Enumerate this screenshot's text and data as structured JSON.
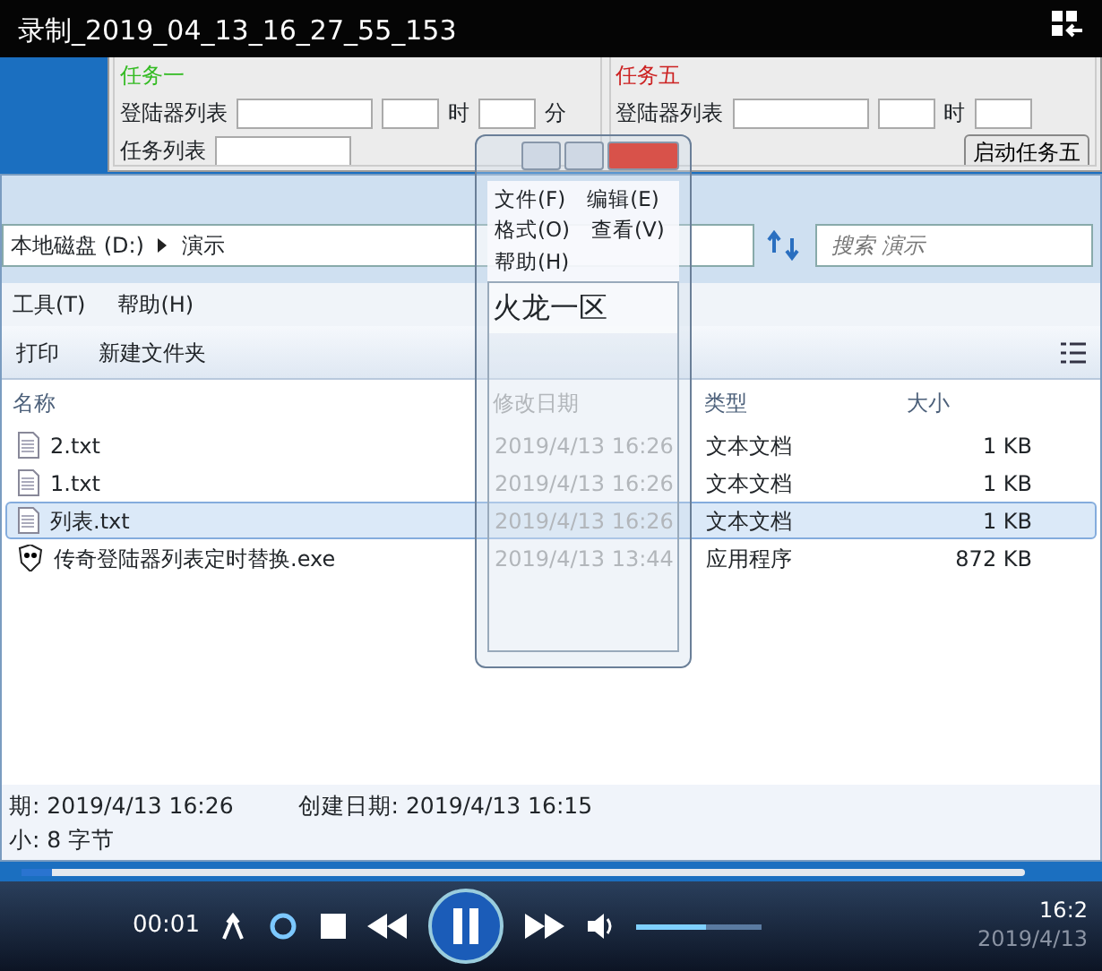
{
  "player": {
    "title": "录制_2019_04_13_16_27_55_153",
    "time": "00:01",
    "playing": true,
    "progress": {
      "level": 0.03
    },
    "volume": {
      "level": 0.55
    }
  },
  "background_app": {
    "tasks": [
      {
        "heading": "任务一",
        "color": "#33bb22",
        "launcher_label": "登陆器列表",
        "hour_label": "时",
        "minute_label": "分",
        "task_list_label": "任务列表"
      },
      {
        "heading": "任务五",
        "color": "#cc2222",
        "launcher_label": "登陆器列表",
        "hour_label": "时",
        "button": "启动任务五"
      }
    ]
  },
  "explorer": {
    "breadcrumbs": [
      "本地磁盘 (D:)",
      "演示"
    ],
    "search": {
      "placeholder": "搜索 演示"
    },
    "menu": [
      "工具(T)",
      "帮助(H)"
    ],
    "toolbar": [
      "打印",
      "新建文件夹"
    ],
    "columns": [
      "名称",
      "修改日期",
      "类型",
      "大小"
    ],
    "rows": [
      {
        "kind": "txt",
        "name": "2.txt",
        "modified": "2019/4/13 16:26",
        "type": "文本文档",
        "size": "1 KB",
        "selected": false
      },
      {
        "kind": "txt",
        "name": "1.txt",
        "modified": "2019/4/13 16:26",
        "type": "文本文档",
        "size": "1 KB",
        "selected": false
      },
      {
        "kind": "txt",
        "name": "列表.txt",
        "modified": "2019/4/13 16:26",
        "type": "文本文档",
        "size": "1 KB",
        "selected": true
      },
      {
        "kind": "exe",
        "name": "传奇登陆器列表定时替换.exe",
        "modified": "2019/4/13 13:44",
        "type": "应用程序",
        "size": "872 KB",
        "selected": false
      }
    ],
    "details": [
      {
        "label": "期:",
        "value": "2019/4/13 16:26"
      },
      {
        "label": "创建日期:",
        "value": "2019/4/13 16:15"
      },
      {
        "label": "小:",
        "value": "8 字节"
      }
    ]
  },
  "notepad": {
    "menu": [
      "文件(F)",
      "编辑(E)",
      "格式(O)",
      "查看(V)",
      "帮助(H)"
    ],
    "text": "火龙一区"
  },
  "taskbar": {
    "time": "16:2",
    "date": "2019/4/13"
  }
}
